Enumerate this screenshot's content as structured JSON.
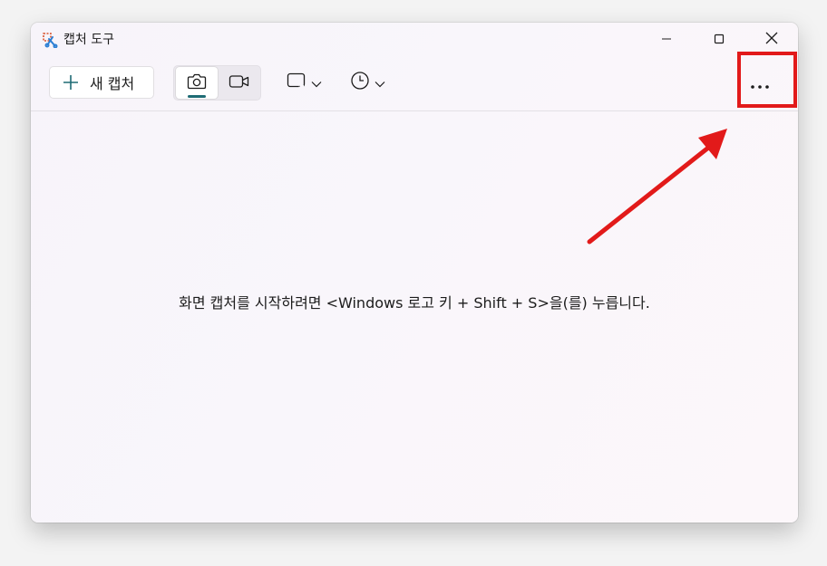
{
  "window": {
    "title": "캡처 도구"
  },
  "toolbar": {
    "new_capture_label": "새 캡처",
    "modes": [
      {
        "name": "camera",
        "selected": true
      },
      {
        "name": "video",
        "selected": false
      }
    ]
  },
  "main": {
    "hint": "화면 캡처를 시작하려면 <Windows 로고 키 + Shift + S>을(를) 누릅니다."
  },
  "colors": {
    "accent": "#1e6b74",
    "annotation": "#e21a1a"
  },
  "icons": {
    "app": "snipping-tool-icon",
    "minimize": "minimize-icon",
    "maximize": "maximize-icon",
    "close": "close-icon",
    "plus": "plus-icon",
    "camera": "camera-icon",
    "video": "video-icon",
    "shape": "rectangle-shape-icon",
    "timer": "clock-icon",
    "more": "more-icon"
  }
}
